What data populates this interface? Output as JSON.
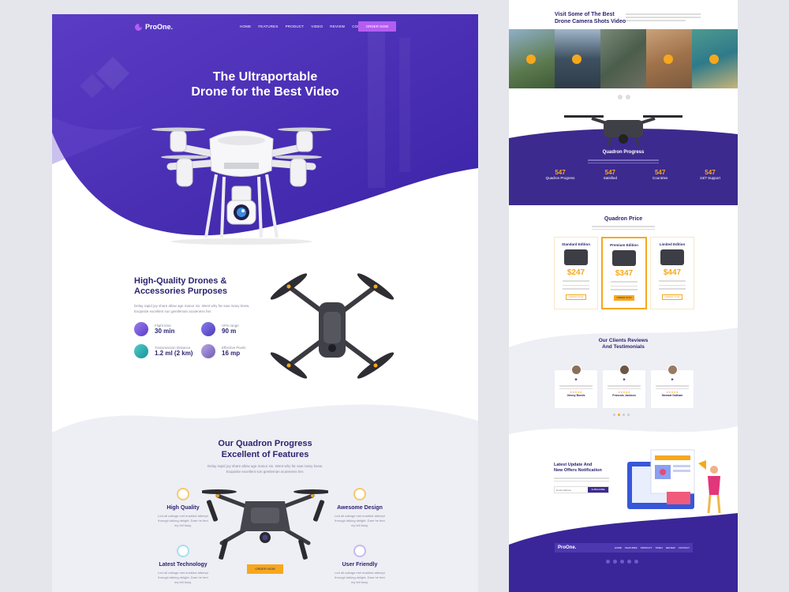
{
  "nav": {
    "logo": "ProOne.",
    "items": [
      "HOME",
      "FEATURES",
      "PRODUCT",
      "VIDEO",
      "REVIEW",
      "CONTACT"
    ],
    "cta": "ORDER NOW"
  },
  "hero": {
    "title_line1": "The Ultraportable",
    "title_line2": "Drone for the Best Video"
  },
  "quality": {
    "title_line1": "High-Quality Drones &",
    "title_line2": "Accessories Purposes",
    "desc_line1": "Delay rapid joy share allow age manor six. Went why far saw many knew.",
    "desc_line2": "Exquisite excellent son gentleman acuteness her.",
    "stats": [
      {
        "label": "Flight time",
        "value": "30 min"
      },
      {
        "label": "VPS range",
        "value": "90 m"
      },
      {
        "label": "Transmission Distance",
        "value": "1.2 ml (2 km)"
      },
      {
        "label": "Effective Pixels",
        "value": "16 mp"
      }
    ]
  },
  "features": {
    "title_line1": "Our Quadron Progress",
    "title_line2": "Excellent of Features",
    "desc_line1": "Delay rapid joy share allow age manor six. Went why far saw many knew.",
    "desc_line2": "Exquisite excellent son gentleman acuteness her.",
    "items": [
      {
        "title": "High Quality",
        "l1": "Led all cottage met enabled attempt",
        "l2": "through talking delight. Dare he feet",
        "l3": "my tell busy."
      },
      {
        "title": "Awesome Design",
        "l1": "Led all cottage met enabled attempt",
        "l2": "through talking delight. Dare he feet",
        "l3": "my tell busy."
      },
      {
        "title": "Latest Technology",
        "l1": "Led all cottage met enabled attempt",
        "l2": "through talking delight. Dare he feet",
        "l3": "my tell busy."
      },
      {
        "title": "User Friendly",
        "l1": "Led all cottage met enabled attempt",
        "l2": "through talking delight. Dare he feet",
        "l3": "my tell busy."
      }
    ],
    "cta": "ORDER NOW"
  },
  "gallery": {
    "title_line1": "Visit Some of The Best",
    "title_line2": "Drone Camera Shots Video"
  },
  "progress": {
    "title": "Quadron Progress",
    "stats": [
      {
        "value": "547",
        "label": "Quadron Progress"
      },
      {
        "value": "547",
        "label": "Satisfied"
      },
      {
        "value": "547",
        "label": "Countries"
      },
      {
        "value": "547",
        "label": "24/7 Support"
      }
    ]
  },
  "pricing": {
    "title": "Quadron Price",
    "plans": [
      {
        "name": "Standard Edition",
        "price": "$247",
        "cta": "ORDER NOW"
      },
      {
        "name": "Premium Edition",
        "price": "$347",
        "cta": "ORDER NOW"
      },
      {
        "name": "Limited Edition",
        "price": "$447",
        "cta": "ORDER NOW"
      }
    ]
  },
  "reviews": {
    "title_line1": "Our Clients Reviews",
    "title_line2": "And Testimonials",
    "items": [
      {
        "name": "Jimmy Bonds"
      },
      {
        "name": "Francois Jackson"
      },
      {
        "name": "Stewart Gutham"
      }
    ]
  },
  "newsletter": {
    "title_line1": "Latest Update And",
    "title_line2": "New Offers Notification",
    "placeholder": "Email address",
    "cta": "SUBSCRIBE"
  },
  "footer": {
    "logo": "ProOne.",
    "items": [
      "HOME",
      "FEATURES",
      "PRODUCT",
      "VIDEO",
      "REVIEW",
      "CONTACT"
    ]
  },
  "colors": {
    "primary": "#3e2a9a",
    "accent": "#f6a81c",
    "cta": "#b45df2"
  }
}
